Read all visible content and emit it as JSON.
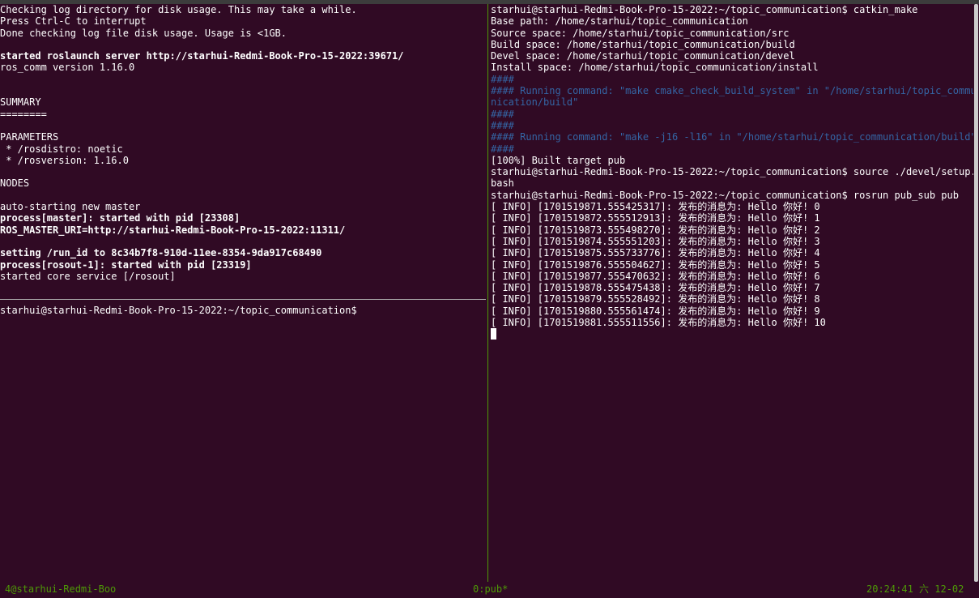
{
  "left_pane": {
    "top_lines": [
      {
        "text": "Checking log directory for disk usage. This may take a while.",
        "style": ""
      },
      {
        "text": "Press Ctrl-C to interrupt",
        "style": ""
      },
      {
        "text": "Done checking log file disk usage. Usage is <1GB.",
        "style": ""
      },
      {
        "text": "",
        "style": ""
      },
      {
        "text": "started roslaunch server http://starhui-Redmi-Book-Pro-15-2022:39671/",
        "style": "bold"
      },
      {
        "text": "ros_comm version 1.16.0",
        "style": ""
      },
      {
        "text": "",
        "style": ""
      },
      {
        "text": "",
        "style": ""
      },
      {
        "text": "SUMMARY",
        "style": ""
      },
      {
        "text": "========",
        "style": ""
      },
      {
        "text": "",
        "style": ""
      },
      {
        "text": "PARAMETERS",
        "style": ""
      },
      {
        "text": " * /rosdistro: noetic",
        "style": ""
      },
      {
        "text": " * /rosversion: 1.16.0",
        "style": ""
      },
      {
        "text": "",
        "style": ""
      },
      {
        "text": "NODES",
        "style": ""
      },
      {
        "text": "",
        "style": ""
      },
      {
        "text": "auto-starting new master",
        "style": ""
      },
      {
        "text": "process[master]: started with pid [23308]",
        "style": "bold"
      },
      {
        "text": "ROS_MASTER_URI=http://starhui-Redmi-Book-Pro-15-2022:11311/",
        "style": "bold"
      },
      {
        "text": "",
        "style": ""
      },
      {
        "text": "setting /run_id to 8c34b7f8-910d-11ee-8354-9da917c68490",
        "style": "bold"
      },
      {
        "text": "process[rosout-1]: started with pid [23319]",
        "style": "bold"
      },
      {
        "text": "started core service [/rosout]",
        "style": ""
      }
    ],
    "bottom_prompt": "starhui@starhui-Redmi-Book-Pro-15-2022:~/topic_communication$"
  },
  "right_pane": {
    "lines": [
      {
        "text": "starhui@starhui-Redmi-Book-Pro-15-2022:~/topic_communication$ catkin_make",
        "style": ""
      },
      {
        "text": "Base path: /home/starhui/topic_communication",
        "style": ""
      },
      {
        "text": "Source space: /home/starhui/topic_communication/src",
        "style": ""
      },
      {
        "text": "Build space: /home/starhui/topic_communication/build",
        "style": ""
      },
      {
        "text": "Devel space: /home/starhui/topic_communication/devel",
        "style": ""
      },
      {
        "text": "Install space: /home/starhui/topic_communication/install",
        "style": ""
      },
      {
        "text": "####",
        "style": "blue"
      },
      {
        "text": "#### Running command: \"make cmake_check_build_system\" in \"/home/starhui/topic_commu",
        "style": "blue"
      },
      {
        "text": "nication/build\"",
        "style": "blue"
      },
      {
        "text": "####",
        "style": "blue"
      },
      {
        "text": "####",
        "style": "blue"
      },
      {
        "text": "#### Running command: \"make -j16 -l16\" in \"/home/starhui/topic_communication/build\"",
        "style": "blue"
      },
      {
        "text": "####",
        "style": "blue"
      },
      {
        "text": "[100%] Built target pub",
        "style": ""
      },
      {
        "text": "starhui@starhui-Redmi-Book-Pro-15-2022:~/topic_communication$ source ./devel/setup.",
        "style": ""
      },
      {
        "text": "bash",
        "style": ""
      },
      {
        "text": "starhui@starhui-Redmi-Book-Pro-15-2022:~/topic_communication$ rosrun pub_sub pub",
        "style": ""
      },
      {
        "text": "[ INFO] [1701519871.555425317]: 发布的消息为: Hello 你好! 0",
        "style": ""
      },
      {
        "text": "[ INFO] [1701519872.555512913]: 发布的消息为: Hello 你好! 1",
        "style": ""
      },
      {
        "text": "[ INFO] [1701519873.555498270]: 发布的消息为: Hello 你好! 2",
        "style": ""
      },
      {
        "text": "[ INFO] [1701519874.555551203]: 发布的消息为: Hello 你好! 3",
        "style": ""
      },
      {
        "text": "[ INFO] [1701519875.555733776]: 发布的消息为: Hello 你好! 4",
        "style": ""
      },
      {
        "text": "[ INFO] [1701519876.555504627]: 发布的消息为: Hello 你好! 5",
        "style": ""
      },
      {
        "text": "[ INFO] [1701519877.555470632]: 发布的消息为: Hello 你好! 6",
        "style": ""
      },
      {
        "text": "[ INFO] [1701519878.555475438]: 发布的消息为: Hello 你好! 7",
        "style": ""
      },
      {
        "text": "[ INFO] [1701519879.555528492]: 发布的消息为: Hello 你好! 8",
        "style": ""
      },
      {
        "text": "[ INFO] [1701519880.555561474]: 发布的消息为: Hello 你好! 9",
        "style": ""
      },
      {
        "text": "[ INFO] [1701519881.555511556]: 发布的消息为: Hello 你好! 10",
        "style": ""
      }
    ]
  },
  "status_bar": {
    "session": "4@starhui-Redmi-Boo",
    "window": "0:pub*",
    "clock": "20:24:41 六 12-02"
  },
  "colors": {
    "background": "#300a24",
    "text": "#ffffff",
    "blue": "#3465a4",
    "status_green": "#4e9a06"
  }
}
